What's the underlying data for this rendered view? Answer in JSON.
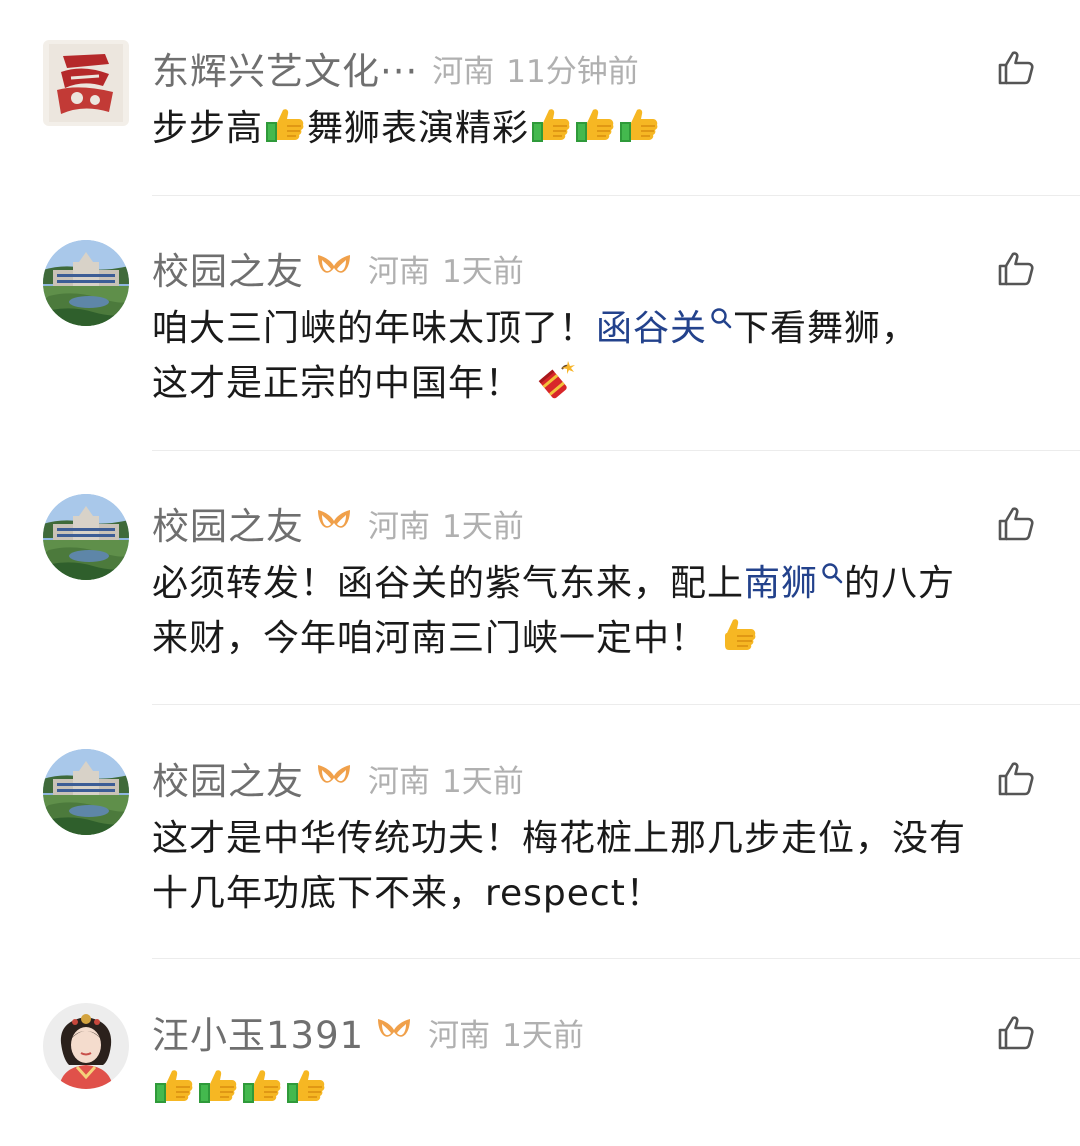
{
  "comments": [
    {
      "username": "东辉兴艺文化···",
      "location": "河南",
      "time": "11分钟前",
      "text_parts": [
        "步步高",
        "舞狮表演精彩"
      ]
    },
    {
      "username": "校园之友",
      "location": "河南",
      "time": "1天前",
      "text_parts": [
        "咱大三门峡的年味太顶了！",
        "函谷关",
        "下看舞狮，",
        "这才是正宗的中国年！"
      ]
    },
    {
      "username": "校园之友",
      "location": "河南",
      "time": "1天前",
      "text_parts": [
        "必须转发！函谷关的紫气东来，配上",
        "南狮",
        "的八方",
        "来财，今年咱河南三门峡一定中！"
      ]
    },
    {
      "username": "校园之友",
      "location": "河南",
      "time": "1天前",
      "text_parts": [
        "这才是中华传统功夫！梅花桩上那几步走位，没有",
        "十几年功底下不来，respect！"
      ]
    },
    {
      "username": "汪小玉1391",
      "location": "河南",
      "time": "1天前",
      "text_parts": []
    }
  ],
  "colors": {
    "link": "#23428c",
    "vip_badge": "#f0a04a",
    "username": "#6f6f6f",
    "meta": "#b0b0b0"
  },
  "icons": {
    "like": "thumbs-up-outline-icon",
    "vip": "vip-badge-icon",
    "search": "search-icon",
    "emoji_thumbs": "thumbs-up-emoji",
    "emoji_firecracker": "firecracker-emoji"
  }
}
